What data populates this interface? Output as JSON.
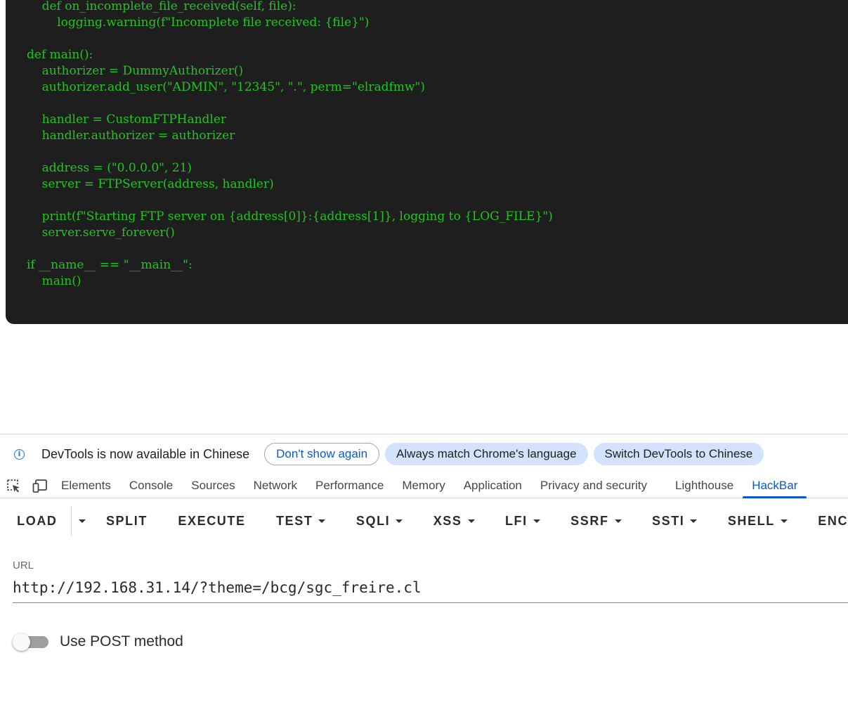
{
  "code": {
    "lines": [
      "    def on_incomplete_file_received(self, file):",
      "        logging.warning(f\"Incomplete file received: {file}\")",
      "",
      "def main():",
      "    authorizer = DummyAuthorizer()",
      "    authorizer.add_user(\"ADMIN\", \"12345\", \".\", perm=\"elradfmw\")",
      "",
      "    handler = CustomFTPHandler",
      "    handler.authorizer = authorizer",
      "",
      "    address = (\"0.0.0.0\", 21)",
      "    server = FTPServer(address, handler)",
      "",
      "    print(f\"Starting FTP server on {address[0]}:{address[1]}, logging to {LOG_FILE}\")",
      "    server.serve_forever()",
      "",
      "if __name__ == \"__main__\":",
      "    main()"
    ],
    "text_color": "#21c521",
    "background": "#1e1e1e"
  },
  "infobar": {
    "icon": "info-icon",
    "message": "DevTools is now available in Chinese",
    "dont_show": "Don't show again",
    "always_match": "Always match Chrome's language",
    "switch": "Switch DevTools to Chinese"
  },
  "tabs": {
    "icons": [
      "inspect-element-icon",
      "device-toolbar-icon"
    ],
    "items": [
      "Elements",
      "Console",
      "Sources",
      "Network",
      "Performance",
      "Memory",
      "Application",
      "Privacy and security",
      "Lighthouse",
      "HackBar"
    ],
    "active": "HackBar"
  },
  "hackbar": {
    "buttons": {
      "load": "LOAD",
      "split": "SPLIT",
      "execute": "EXECUTE",
      "test": "TEST",
      "sqli": "SQLI",
      "xss": "XSS",
      "lfi": "LFI",
      "ssrf": "SSRF",
      "ssti": "SSTI",
      "shell": "SHELL",
      "enc": "ENC"
    },
    "url_label": "URL",
    "url_value": "http://192.168.31.14/?theme=/bcg/sgc_freire.cl",
    "post_label": "Use POST method",
    "post_enabled": false
  },
  "colors": {
    "accent": "#0b57d0",
    "pill_fill": "#d3e3fd"
  }
}
